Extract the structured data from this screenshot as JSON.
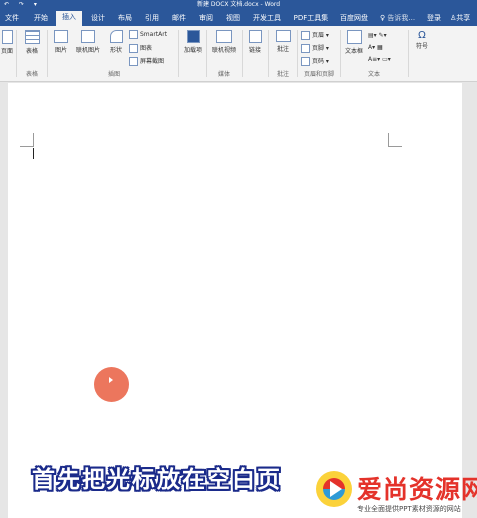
{
  "window": {
    "title": "新建 DOCX 文档.docx - Word",
    "quick_access": "↶ ↷ ▾"
  },
  "tabs": [
    "文件",
    "开始",
    "插入",
    "设计",
    "布局",
    "引用",
    "邮件",
    "审阅",
    "视图",
    "开发工具",
    "PDF工具集",
    "百度网盘"
  ],
  "active_tab": "插入",
  "tell_me": "告诉我...",
  "login": "登录",
  "share": "共享",
  "ribbon": {
    "pages": "页面",
    "table": "表格",
    "picture": "图片",
    "online_picture": "联机图片",
    "shapes": "形状",
    "smartart": "SmartArt",
    "chart": "图表",
    "screenshot": "屏幕截图",
    "addins": "加载项",
    "online_video": "联机视频",
    "link": "链接",
    "comment": "批注",
    "header": "页眉",
    "footer": "页脚",
    "page_number": "页码",
    "textbox": "文本框",
    "symbol": "符号"
  },
  "groups": {
    "tables": "表格",
    "illustrations": "插图",
    "media": "媒体",
    "comments": "批注",
    "header_footer": "页眉和页脚",
    "text": "文本"
  },
  "subtitle": "首先把光标放在空白页",
  "watermark": {
    "name": "爱尚资源网",
    "tagline": "专业全面提供PPT素材资源的网站"
  },
  "colors": {
    "word_blue": "#2b579a",
    "cursor_highlight": "#ec6f55",
    "subtitle_outline": "#1a2a8a",
    "watermark_red": "#e4322a"
  }
}
